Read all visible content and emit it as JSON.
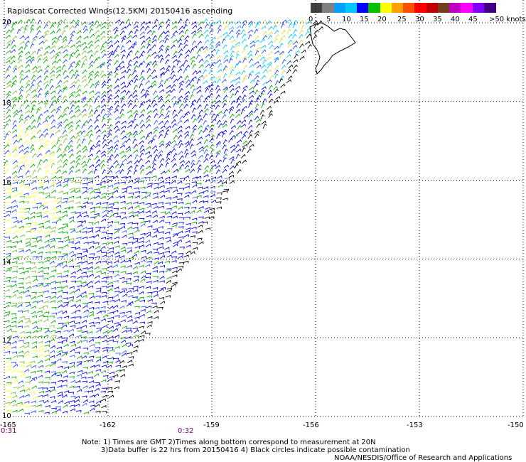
{
  "title": "Rapidscat Corrected Winds(12.5KM) 20150416 ascending",
  "scale": {
    "labels": [
      "0",
      "5",
      "10",
      "15",
      "20",
      "25",
      "30",
      "35",
      "40",
      "45",
      ">50 knots"
    ],
    "colors": [
      "#404040",
      "#808080",
      "#00a0ff",
      "#00c8ff",
      "#0000ff",
      "#00c000",
      "#ffff00",
      "#ffa000",
      "#ff5000",
      "#ff0000",
      "#c00000",
      "#704020",
      "#c000c0",
      "#ff00ff",
      "#8000ff",
      "#400080"
    ]
  },
  "map": {
    "lon_range": [
      -165,
      -150
    ],
    "lat_range": [
      10,
      21
    ],
    "lat_ticks": [
      20,
      18,
      16,
      14,
      12,
      10
    ],
    "lon_ticks": [
      -165,
      -162,
      -159,
      -156,
      -153,
      -150
    ],
    "lat_labels": [
      "20",
      "18",
      "16",
      "14",
      "12",
      "10"
    ],
    "lon_labels": [
      "-165",
      "-162",
      "-159",
      "-156",
      "-153",
      "-150"
    ],
    "grid": true
  },
  "times": [
    "0:31",
    "0:32"
  ],
  "notes": {
    "line1": "Note: 1) Times are GMT 2)Times along bottom correspond to measurement at 20N",
    "line2": "3)Data buffer is 22 hrs from 20150416 4) Black circles indicate possible contamination",
    "credit": "NOAA/NESDIS/Office of Research and Applications"
  }
}
